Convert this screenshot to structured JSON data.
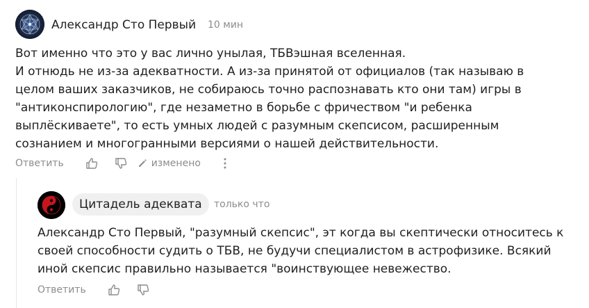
{
  "comment": {
    "author": "Александр Сто Первый",
    "time": "10 мин",
    "lines": [
      "Вот именно что это у вас лично унылая, ТБВэшная вселенная.",
      "И отнюдь не из-за адекватности. А из-за принятой от официалов (так называю в",
      "целом ваших заказчиков, не собираюсь точно распознавать кто они там) игры в",
      "\"антиконспирологию\", где незаметно в борьбе с фричеством \"и ребенка",
      "выплёскиваете\", то есть умных людей с разумным скепсисом, расширенным",
      "сознанием и многогранными версиями о нашей действительности."
    ],
    "actions": {
      "reply_label": "Ответить",
      "like_icon": "thumbs-up-icon",
      "dislike_icon": "thumbs-down-icon",
      "edited_label": "изменено",
      "more_icon": "more-vertical-icon"
    }
  },
  "reply": {
    "author": "Цитадель адеквата",
    "time": "только что",
    "lines": [
      "Александр Сто Первый, \"разумный скепсис\", эт когда вы скептически относитесь к",
      "своей способности судить о ТБВ, не будучи специалистом в астрофизике. Всякий",
      "иной скепсис правильно называется \"воинствующее невежество."
    ],
    "actions": {
      "reply_label": "Ответить",
      "like_icon": "thumbs-up-icon",
      "dislike_icon": "thumbs-down-icon"
    }
  },
  "colors": {
    "text": "#1f1f1f",
    "muted": "#8c8c8c",
    "pill_bg": "#f0f0f0",
    "thread_line": "#e6e6e6",
    "yin_yang_red": "#c4161c"
  }
}
